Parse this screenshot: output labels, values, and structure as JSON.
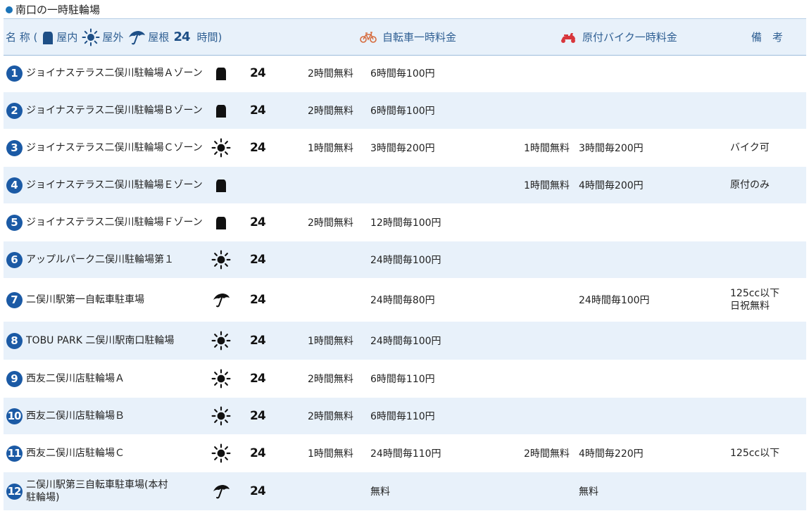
{
  "section": {
    "title": "南口の一時駐輪場"
  },
  "header": {
    "name_label": "名 称 (",
    "legend_indoor": "屋内",
    "legend_outdoor": "屋外",
    "legend_roof": "屋根",
    "legend_24": "24",
    "legend_24_suffix": "時間)",
    "bicycle_label": "自転車一時料金",
    "moped_label": "原付バイク一時料金",
    "note_label": "備　考"
  },
  "colors": {
    "accent": "#1b5aa5",
    "header_bg": "#e8f1fa",
    "header_text": "#2f5f93",
    "bike_icon": "#d66a3c",
    "moped_icon": "#d8363c"
  },
  "rows": [
    {
      "num": "1",
      "name": "ジョイナステラス二俣川駐輪場Ａゾーン",
      "type": "indoor",
      "h24": "24",
      "bike_free": "2時間無料",
      "bike_rate": "6時間毎100円",
      "moped_free": "",
      "moped_rate": "",
      "note": ""
    },
    {
      "num": "2",
      "name": "ジョイナステラス二俣川駐輪場Ｂゾーン",
      "type": "indoor",
      "h24": "24",
      "bike_free": "2時間無料",
      "bike_rate": "6時間毎100円",
      "moped_free": "",
      "moped_rate": "",
      "note": ""
    },
    {
      "num": "3",
      "name": "ジョイナステラス二俣川駐輪場Ｃゾーン",
      "type": "outdoor",
      "h24": "24",
      "bike_free": "1時間無料",
      "bike_rate": "3時間毎200円",
      "moped_free": "1時間無料",
      "moped_rate": "3時間毎200円",
      "note": "バイク可"
    },
    {
      "num": "4",
      "name": "ジョイナステラス二俣川駐輪場Ｅゾーン",
      "type": "indoor",
      "h24": "",
      "bike_free": "",
      "bike_rate": "",
      "moped_free": "1時間無料",
      "moped_rate": "4時間毎200円",
      "note": "原付のみ"
    },
    {
      "num": "5",
      "name": "ジョイナステラス二俣川駐輪場Ｆゾーン",
      "type": "indoor",
      "h24": "24",
      "bike_free": "2時間無料",
      "bike_rate": "12時間毎100円",
      "moped_free": "",
      "moped_rate": "",
      "note": ""
    },
    {
      "num": "6",
      "name": "アップルパーク二俣川駐輪場第１",
      "type": "outdoor",
      "h24": "24",
      "bike_free": "",
      "bike_rate": "24時間毎100円",
      "moped_free": "",
      "moped_rate": "",
      "note": ""
    },
    {
      "num": "7",
      "name": "二俣川駅第一自転車駐車場",
      "type": "roof",
      "h24": "24",
      "bike_free": "",
      "bike_rate": "24時間毎80円",
      "moped_free": "",
      "moped_rate": "24時間毎100円",
      "note": "125cc以下",
      "note2": "日祝無料"
    },
    {
      "num": "8",
      "name": "TOBU PARK 二俣川駅南口駐輪場",
      "type": "outdoor",
      "h24": "24",
      "bike_free": "1時間無料",
      "bike_rate": "24時間毎100円",
      "moped_free": "",
      "moped_rate": "",
      "note": ""
    },
    {
      "num": "9",
      "name": "西友二俣川店駐輪場Ａ",
      "type": "outdoor",
      "h24": "24",
      "bike_free": "2時間無料",
      "bike_rate": "6時間毎110円",
      "moped_free": "",
      "moped_rate": "",
      "note": ""
    },
    {
      "num": "10",
      "name": "西友二俣川店駐輪場Ｂ",
      "type": "outdoor",
      "h24": "24",
      "bike_free": "2時間無料",
      "bike_rate": "6時間毎110円",
      "moped_free": "",
      "moped_rate": "",
      "note": ""
    },
    {
      "num": "11",
      "name": "西友二俣川店駐輪場Ｃ",
      "type": "outdoor",
      "h24": "24",
      "bike_free": "1時間無料",
      "bike_rate": "24時間毎110円",
      "moped_free": "2時間無料",
      "moped_rate": "4時間毎220円",
      "note": "125cc以下"
    },
    {
      "num": "12",
      "name": "二俣川駅第三自転車駐車場(本村",
      "name2": "駐輪場)",
      "type": "roof",
      "h24": "24",
      "bike_free": "",
      "bike_rate": "無料",
      "moped_free": "",
      "moped_rate": "無料",
      "note": ""
    }
  ]
}
